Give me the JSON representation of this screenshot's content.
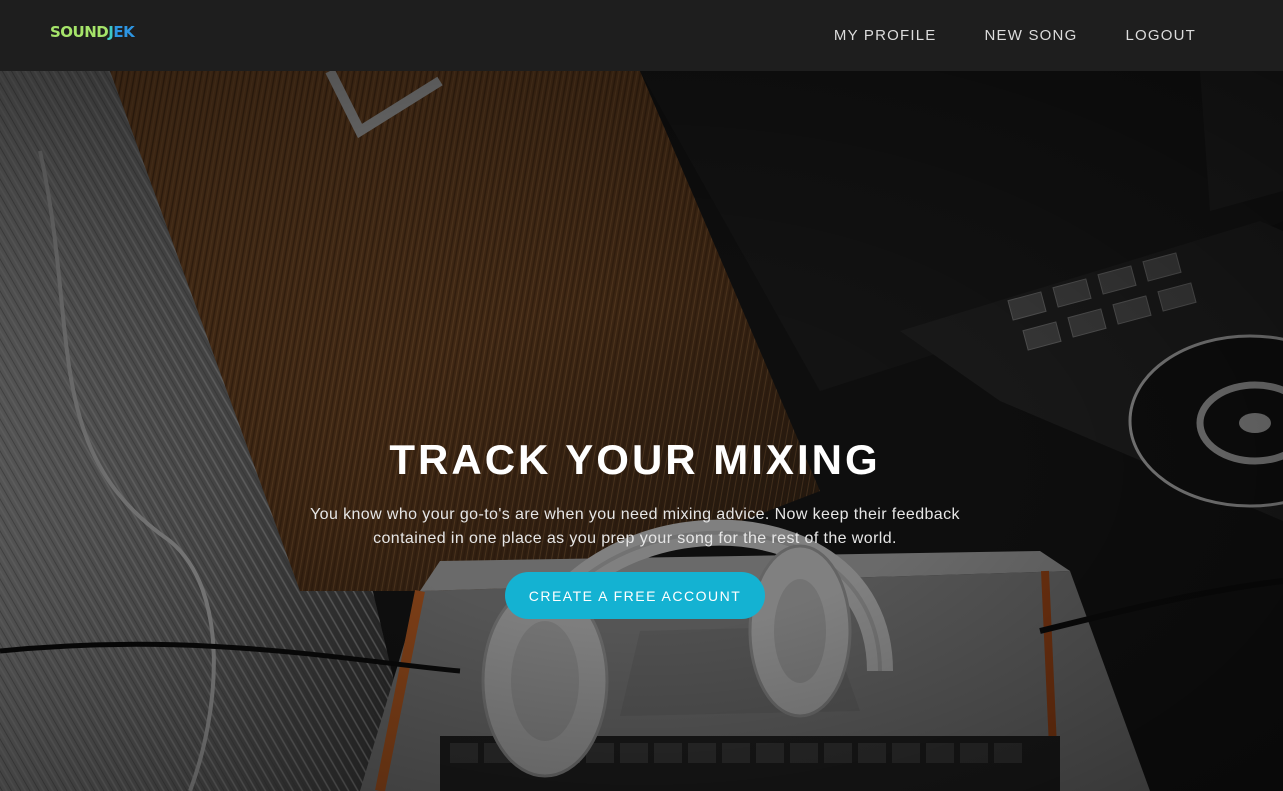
{
  "navbar": {
    "logo_text": "SOUNDJEK",
    "items": [
      {
        "label": "MY PROFILE"
      },
      {
        "label": "NEW SONG"
      },
      {
        "label": "LOGOUT"
      }
    ]
  },
  "hero": {
    "headline": "TRACK YOUR MIXING",
    "subtext": "You know who your go-to's are when you need mixing advice. Now keep their feedback contained in one place as you prep your song for the rest of the world.",
    "cta_label": "CREATE A FREE ACCOUNT"
  },
  "colors": {
    "navbar_bg": "#1e1e1e",
    "cta_bg": "#14b2d2",
    "logo_gradient": [
      "#9fe26a",
      "#3fd0c4",
      "#2a8fe0"
    ]
  },
  "icons": [
    "headphones-image",
    "dj-controller-image",
    "laptop-image"
  ]
}
